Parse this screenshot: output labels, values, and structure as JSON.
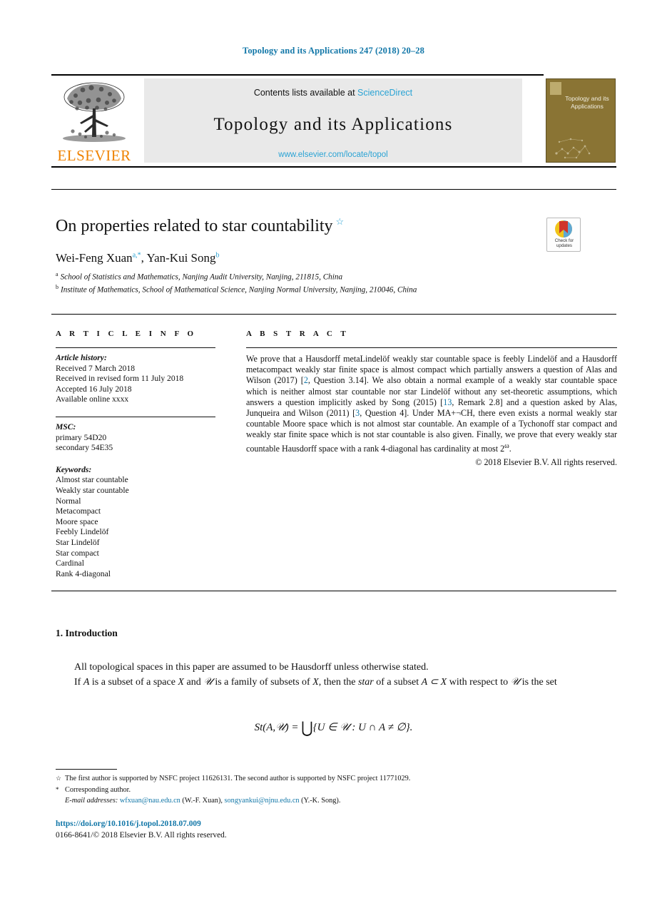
{
  "running_head": "Topology and its Applications 247 (2018) 20–28",
  "masthead": {
    "contents_prefix": "Contents lists available at ",
    "sciencedirect": "ScienceDirect",
    "journal_name": "Topology and its Applications",
    "journal_url": "www.elsevier.com/locate/topol",
    "publisher": "ELSEVIER",
    "cover_title": "Topology and its Applications",
    "link_color": "#2aa3d4",
    "publisher_color": "#ef8200",
    "cover_color": "#8a7434"
  },
  "article": {
    "title": "On properties related to star countability",
    "title_footnote_mark": "☆",
    "authors": "Wei-Feng Xuan",
    "author_1": "Wei-Feng Xuan",
    "author_1_marks": "a,*",
    "author_2": "Yan-Kui Song",
    "author_2_marks": "b",
    "affiliation_a_mark": "a",
    "affiliation_a": "School of Statistics and Mathematics, Nanjing Audit University, Nanjing, 211815, China",
    "affiliation_b_mark": "b",
    "affiliation_b": "Institute of Mathematics, School of Mathematical Science, Nanjing Normal University, Nanjing, 210046, China"
  },
  "crossmark": {
    "line1": "Check for",
    "line2": "updates"
  },
  "info": {
    "heading": "A R T I C L E   I N F O",
    "history_title": "Article history:",
    "history": [
      "Received 7 March 2018",
      "Received in revised form 11 July 2018",
      "Accepted 16 July 2018",
      "Available online xxxx"
    ],
    "msc_title": "MSC:",
    "msc": [
      "primary 54D20",
      "secondary 54E35"
    ],
    "keywords_title": "Keywords:",
    "keywords": [
      "Almost star countable",
      "Weakly star countable",
      "Normal",
      "Metacompact",
      "Moore space",
      "Feebly Lindelöf",
      "Star Lindelöf",
      "Star compact",
      "Cardinal",
      "Rank 4-diagonal"
    ]
  },
  "abstract": {
    "heading": "A B S T R A C T",
    "part1": "We prove that a Hausdorff metaLindelöf weakly star countable space is feebly Lindelöf and a Hausdorff metacompact weakly star finite space is almost compact which partially answers a question of Alas and Wilson (2017) [",
    "ref1": "2",
    "part2": ", Question 3.14]. We also obtain a normal example of a weakly star countable space which is neither almost star countable nor star Lindelöf without any set-theoretic assumptions, which answers a question implicitly asked by Song (2015) [",
    "ref2": "13",
    "part3": ", Remark 2.8] and a question asked by Alas, Junqueira and Wilson (2011) [",
    "ref3": "3",
    "part4": ", Question 4]. Under MA+¬CH, there even exists a normal weakly star countable Moore space which is not almost star countable. An example of a Tychonoff star compact and weakly star finite space which is not star countable is also given. Finally, we prove that every weakly star countable Hausdorff space with a rank 4-diagonal has cardinality at most 2",
    "part4_sup": "ω",
    "part5": ".",
    "copyright": "© 2018 Elsevier B.V. All rights reserved."
  },
  "body": {
    "section_number": "1.",
    "section_title": "Introduction",
    "para1": "All topological spaces in this paper are assumed to be Hausdorff unless otherwise stated.",
    "para2_a": "If ",
    "para2_A": "A",
    "para2_b": " is a subset of a space ",
    "para2_X": "X",
    "para2_c": " and ",
    "para2_U": "𝒰",
    "para2_d": " is a family of subsets of ",
    "para2_X2": "X",
    "para2_e": ", then the ",
    "para2_star": "star",
    "para2_f": " of a subset ",
    "para2_AX": "A ⊂ X",
    "para2_g": " with respect to ",
    "para2_U2": "𝒰",
    "para2_h": " is the set",
    "equation": "St(A,𝒰) = ⋃{U ∈ 𝒰 : U ∩ A ≠ ∅}.",
    "eq_lhs": "St(A,𝒰) =",
    "eq_cup": "⋃",
    "eq_rhs": "{U ∈ 𝒰 : U ∩ A ≠ ∅}."
  },
  "footnotes": {
    "fn1_mark": "☆",
    "fn1": "The first author is supported by NSFC project 11626131. The second author is supported by NSFC project 11771029.",
    "fn2_mark": "*",
    "fn2": "Corresponding author.",
    "email_label": "E-mail addresses:",
    "email_1": "wfxuan@nau.edu.cn",
    "email_1_owner": "(W.-F. Xuan),",
    "email_2": "songyankui@njnu.edu.cn",
    "email_2_owner": "(Y.-K. Song)."
  },
  "footer": {
    "doi": "https://doi.org/10.1016/j.topol.2018.07.009",
    "issn": "0166-8641/© 2018 Elsevier B.V. All rights reserved."
  }
}
